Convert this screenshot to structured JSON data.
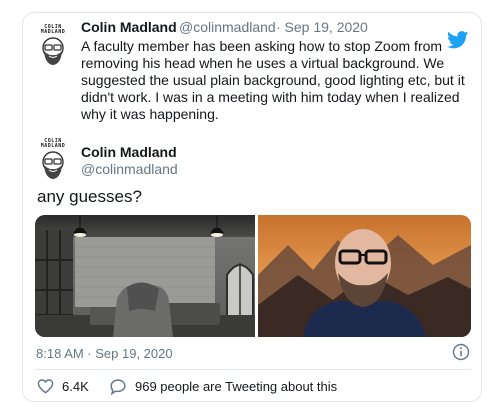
{
  "tweet": {
    "author": {
      "name": "Colin Madland",
      "handle": "@colinmadland",
      "date": "· Sep 19, 2020",
      "avatar_sign": "COLIN MADLAND"
    },
    "text": "A faculty member has been asking how to stop Zoom from removing his head when he uses a virtual background. We suggested the usual plain background, good lighting etc, but it didn't work. I was in a meeting with him today when I realized why it was happening."
  },
  "reply": {
    "author": {
      "name": "Colin Madland",
      "handle": "@colinmadland",
      "avatar_sign": "COLIN MADLAND"
    },
    "text": "any guesses?",
    "timestamp": "8:18 AM · Sep 19, 2020",
    "likes": "6.4K",
    "conversation": "969 people are Tweeting about this"
  },
  "icons": {
    "brand": "twitter-bird-icon",
    "info": "info-icon",
    "like": "heart-icon",
    "reply": "speech-bubble-icon"
  },
  "colors": {
    "brand": "#1da1f2",
    "text": "#14171a",
    "secondary": "#657786",
    "border": "#e1e8ed"
  }
}
